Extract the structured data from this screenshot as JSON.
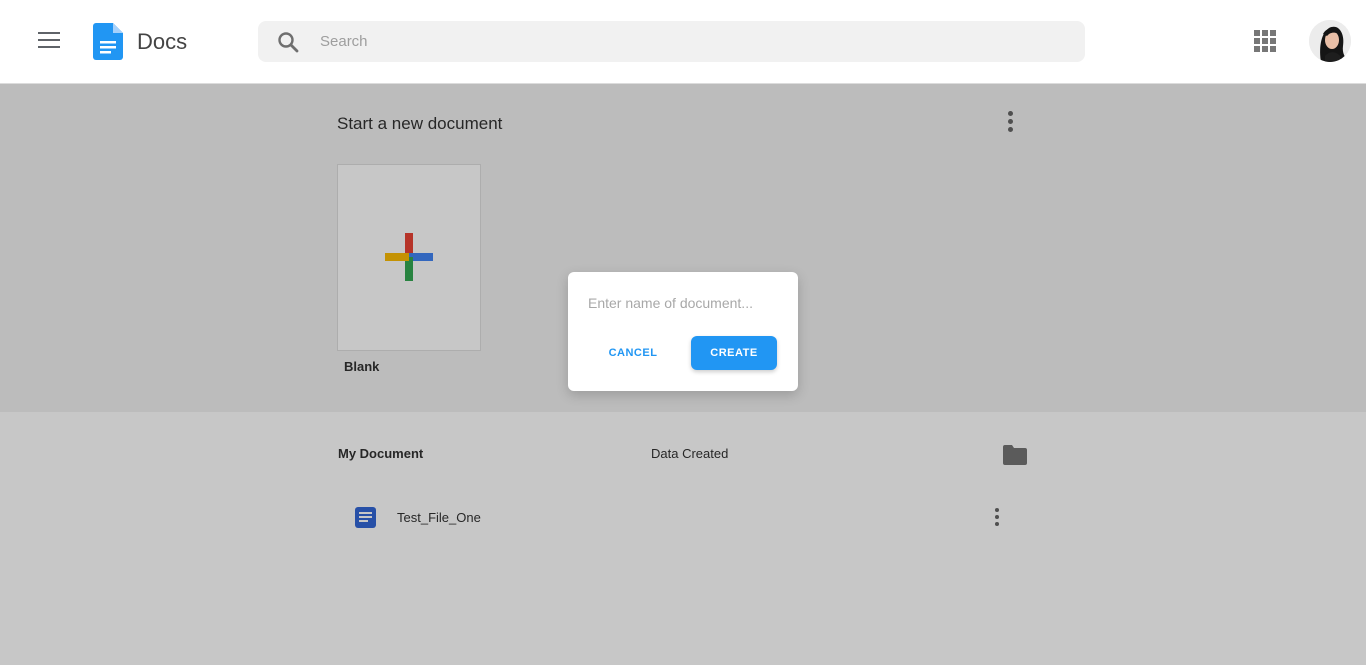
{
  "header": {
    "brand": "Docs",
    "search": {
      "placeholder": "Search",
      "value": ""
    }
  },
  "templates": {
    "title": "Start a new document",
    "blank_label": "Blank"
  },
  "documents": {
    "columns": [
      "My Document",
      "Data Created"
    ],
    "rows": [
      {
        "name": "Test_File_One"
      }
    ]
  },
  "dialog": {
    "input_placeholder": "Enter name of document...",
    "input_value": "",
    "cancel_label": "CANCEL",
    "create_label": "CREATE"
  },
  "colors": {
    "accent": "#2196f3",
    "doc_icon": "#3367d6",
    "logo": "#2196f3"
  }
}
